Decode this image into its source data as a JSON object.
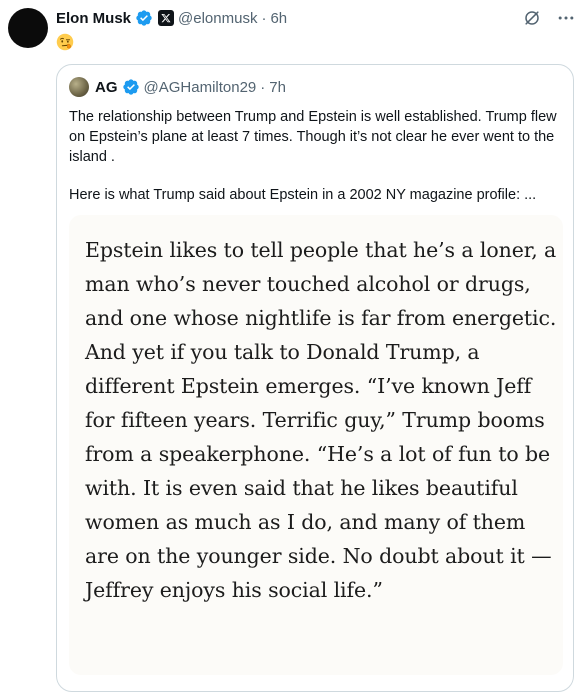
{
  "post": {
    "author_name": "Elon Musk",
    "author_handle": "@elonmusk",
    "separator": "·",
    "time": "6h",
    "emoji_icon": "raised-eyebrow-face-icon"
  },
  "quoted": {
    "author_name": "AG",
    "author_handle": "@AGHamilton29",
    "separator": "·",
    "time": "7h",
    "paragraph1": "The relationship between Trump and Epstein is well established. Trump flew on Epstein’s plane at least 7 times. Though it’s not clear he ever went to the island .",
    "paragraph2": "Here is what Trump said about Epstein in a 2002 NY magazine profile: ...",
    "clipping_text": "Epstein likes to tell people that he’s a loner, a man who’s never touched alcohol or drugs, and one whose nightlife is far from energetic. And yet if you talk to Donald Trump, a different Epstein emerges. “I’ve known Jeff for fifteen years. Terrific guy,” Trump booms from a speakerphone. “He’s a lot of fun to be with. It is even said that he likes beautiful women as much as I do, and many of them are on the younger side. No doubt about it — Jeffrey enjoys his social life.”"
  },
  "colors": {
    "verified_blue": "#1d9bf0",
    "text_primary": "#0f1419",
    "text_secondary": "#536471",
    "border": "#cfd9de"
  }
}
